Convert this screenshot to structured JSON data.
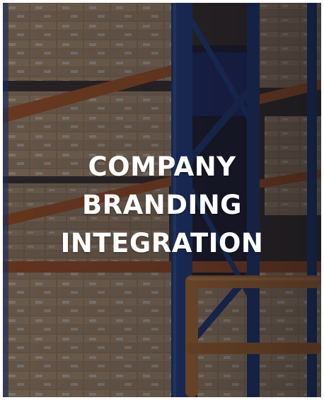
{
  "card": {
    "title_lines": [
      "COMPANY",
      "BRANDING",
      "INTEGRATION"
    ],
    "background_image": "warehouse-pallet-racking-with-cardboard-boxes",
    "colors": {
      "overlay": "#14162a",
      "text": "#ffffff",
      "rack_upright": "#1f3f86",
      "rack_beam": "#b65a1c",
      "safety_rail": "#c8782e",
      "boxes": "#b89870"
    }
  }
}
